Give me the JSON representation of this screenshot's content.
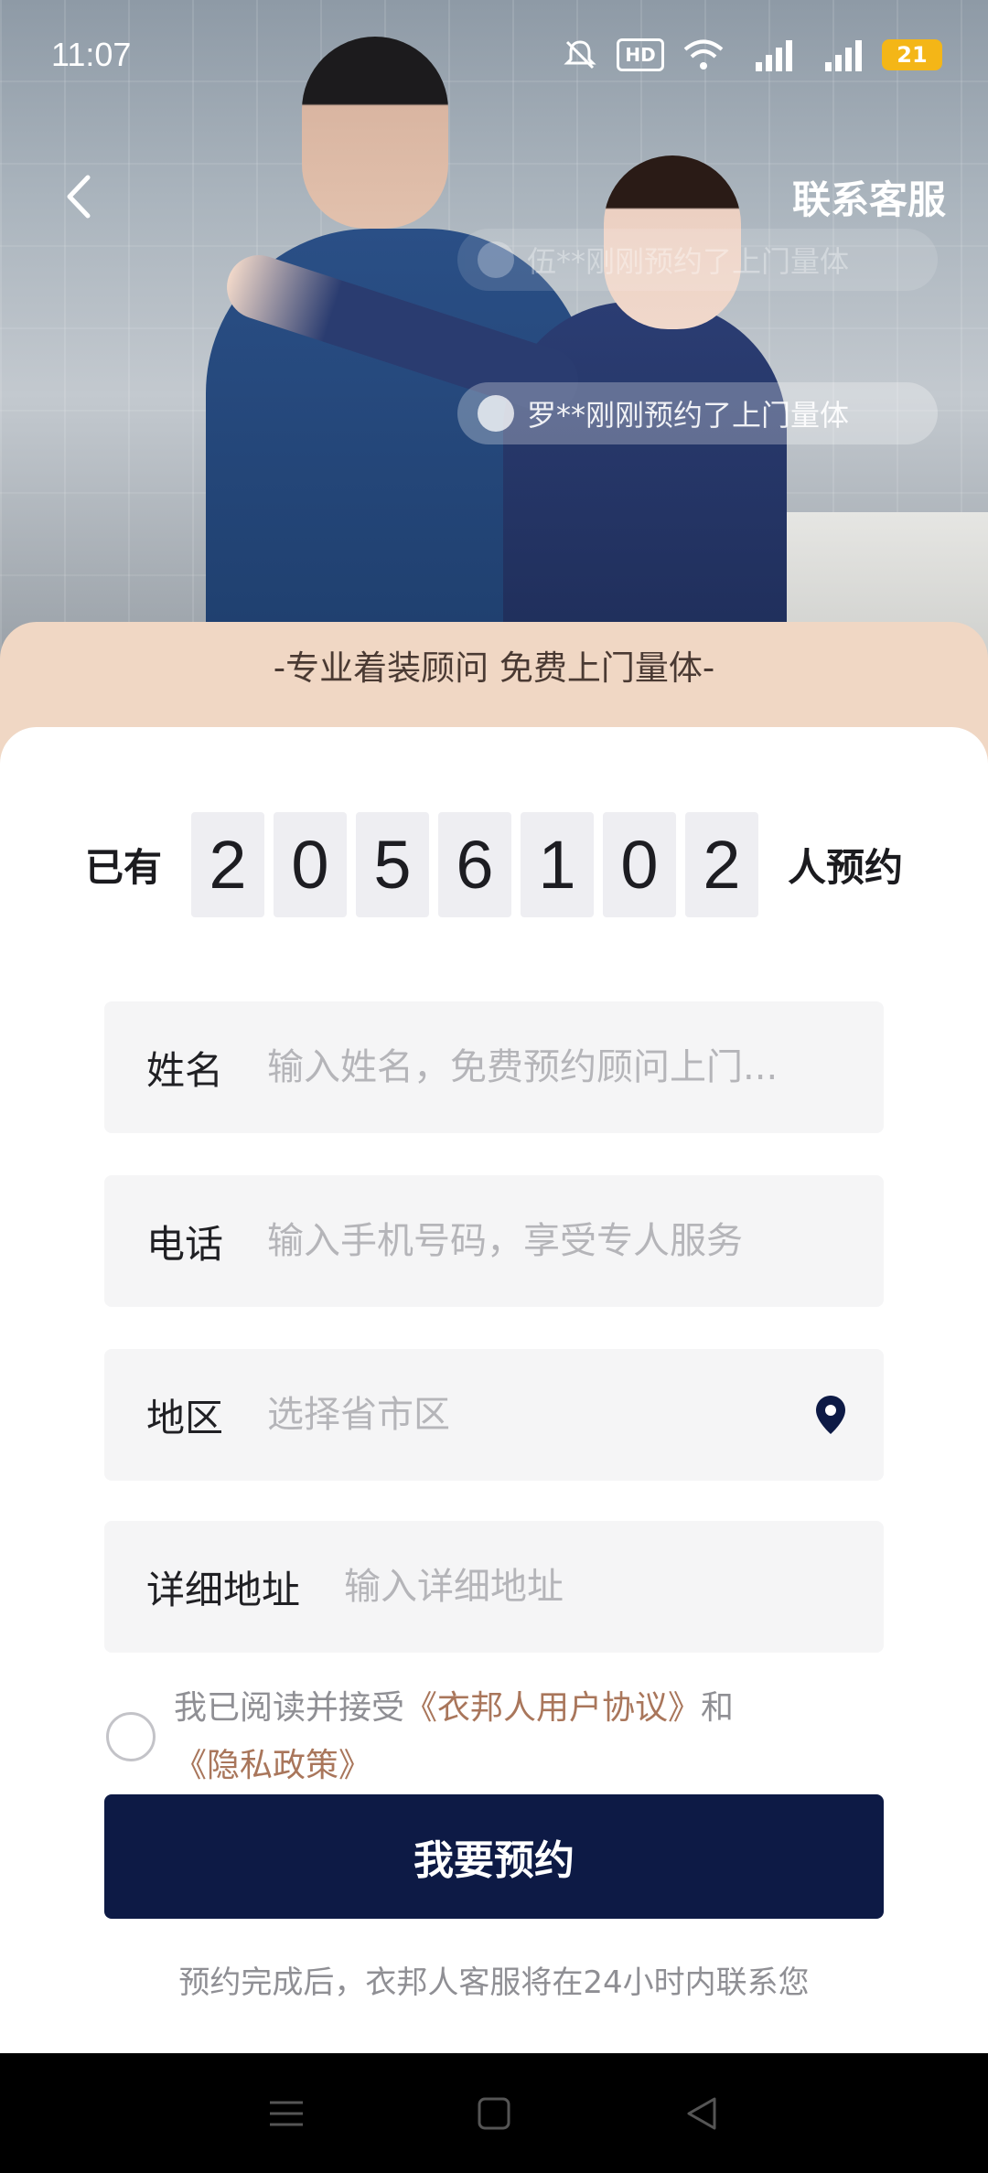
{
  "status_bar": {
    "time": "11:07",
    "hd_label": "HD",
    "battery": "21"
  },
  "header": {
    "contact_label": "联系客服"
  },
  "ticker": {
    "top_message": "伍**刚刚预约了上门量体",
    "bottom_message": "罗**刚刚预约了上门量体"
  },
  "banner": {
    "text": "-专业着装顾问 免费上门量体-"
  },
  "counter": {
    "prefix": "已有",
    "digits": [
      "2",
      "0",
      "5",
      "6",
      "1",
      "0",
      "2"
    ],
    "suffix": "人预约"
  },
  "form": {
    "name": {
      "label": "姓名",
      "placeholder": "输入姓名，免费预约顾问上门..."
    },
    "phone": {
      "label": "电话",
      "placeholder": "输入手机号码，享受专人服务"
    },
    "region": {
      "label": "地区",
      "placeholder": "选择省市区",
      "icon": "location-pin-icon"
    },
    "address": {
      "label": "详细地址",
      "placeholder": "输入详细地址"
    }
  },
  "agreement": {
    "prefix": "我已阅读并接受",
    "user_agreement": "《衣邦人用户协议》",
    "and": "和",
    "privacy_policy": "《隐私政策》"
  },
  "submit_label": "我要预约",
  "footnote": "预约完成后，衣邦人客服将在24小时内联系您",
  "colors": {
    "primary": "#0d1a45",
    "banner": "#f0d7c4",
    "link": "#a9765b"
  }
}
